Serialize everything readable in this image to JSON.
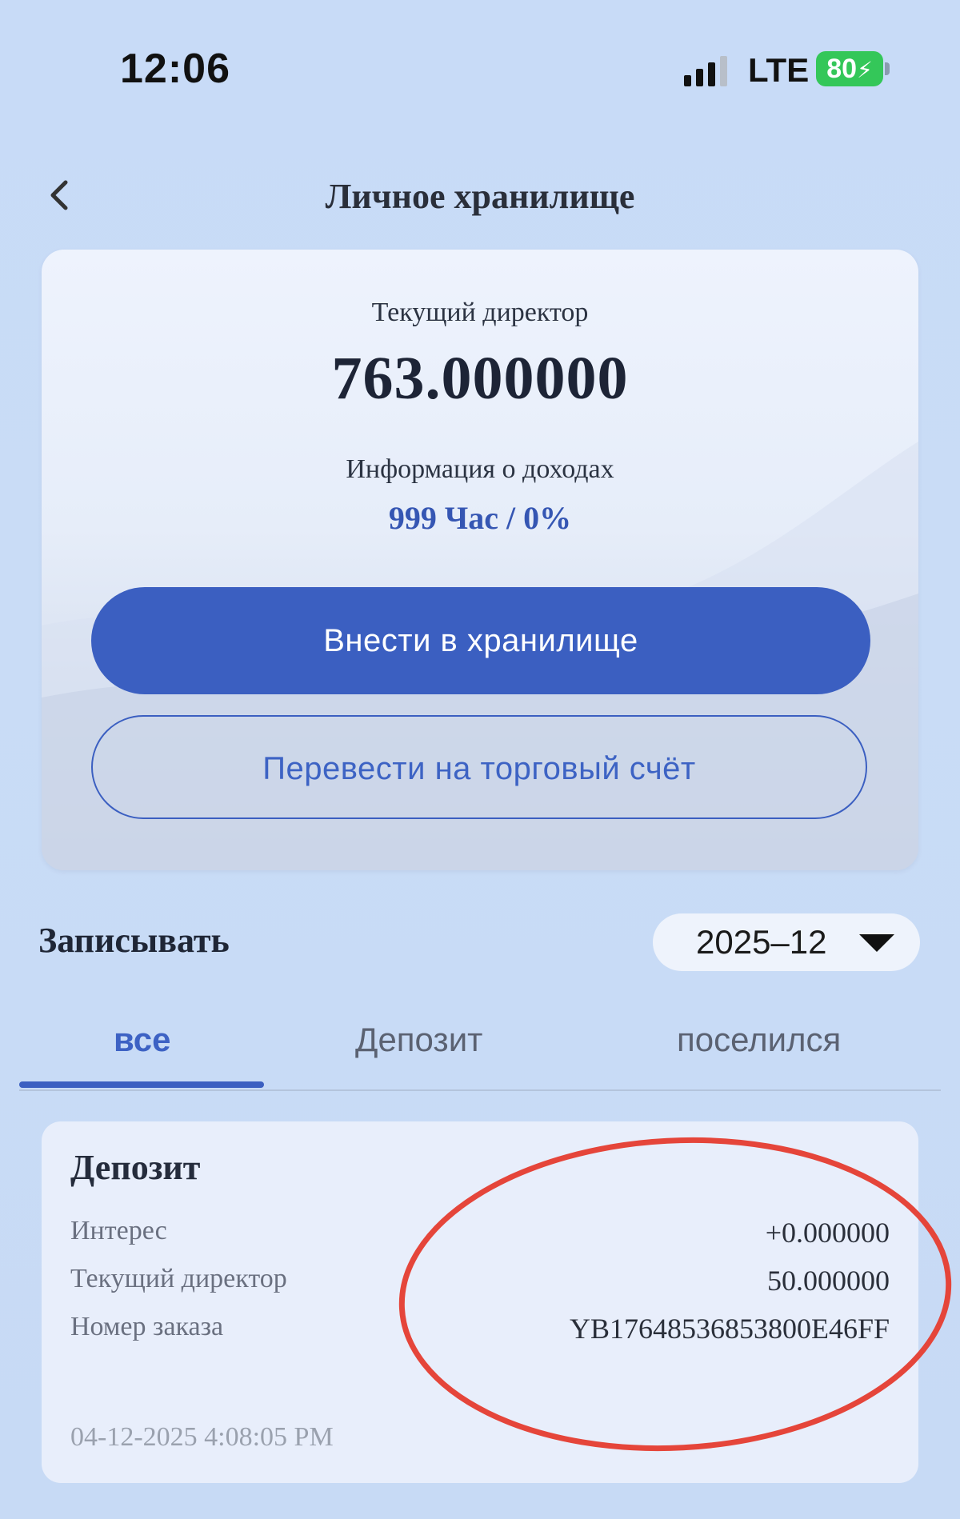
{
  "status_bar": {
    "time": "12:06",
    "network": "LTE",
    "battery": "80"
  },
  "header": {
    "title": "Личное хранилище"
  },
  "vault": {
    "principal_label": "Текущий директор",
    "principal_value": "763.000000",
    "income_label": "Информация о доходах",
    "income_value": "999 Час / 0%",
    "deposit_button": "Внести в хранилище",
    "transfer_button": "Перевести на торговый счёт"
  },
  "records": {
    "title": "Записывать",
    "month": "2025–12",
    "tabs": [
      {
        "label": "все",
        "active": true
      },
      {
        "label": "Депозит",
        "active": false
      },
      {
        "label": "поселился",
        "active": false
      }
    ],
    "items": [
      {
        "type": "Депозит",
        "interest_label": "Интерес",
        "interest_value": "+0.000000",
        "principal_label": "Текущий директор",
        "principal_value": "50.000000",
        "order_label": "Номер заказа",
        "order_value": "YB17648536853800E46FF",
        "date": "04-12-2025 4:08:05 PM"
      }
    ]
  },
  "colors": {
    "primary": "#3b5fc1",
    "background": "#c9dcf6",
    "annotation": "#e5453a",
    "battery": "#34c759"
  }
}
